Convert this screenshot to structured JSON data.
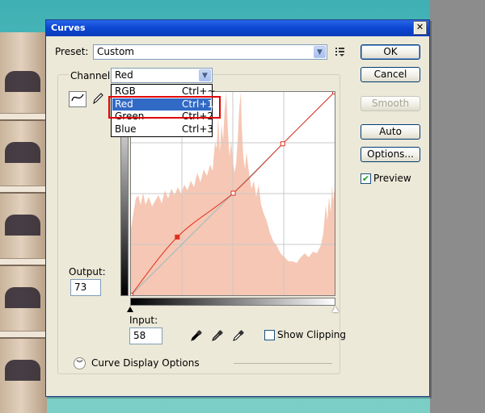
{
  "dialog": {
    "title": "Curves",
    "close_glyph": "✕"
  },
  "preset": {
    "label": "Preset:",
    "value": "Custom"
  },
  "channel": {
    "label": "Channel:",
    "value": "Red",
    "menu_items": [
      {
        "label": "RGB",
        "shortcut": "Ctrl+~",
        "selected": false
      },
      {
        "label": "Red",
        "shortcut": "Ctrl+1",
        "selected": true
      },
      {
        "label": "Green",
        "shortcut": "Ctrl+2",
        "selected": false
      },
      {
        "label": "Blue",
        "shortcut": "Ctrl+3",
        "selected": false
      }
    ]
  },
  "buttons": {
    "ok": "OK",
    "cancel": "Cancel",
    "smooth": "Smooth",
    "auto": "Auto",
    "options": "Options..."
  },
  "preview": {
    "label": "Preview",
    "checked": true
  },
  "output": {
    "label": "Output:",
    "value": "73"
  },
  "input": {
    "label": "Input:",
    "value": "58"
  },
  "show_clipping": {
    "label": "Show Clipping",
    "checked": false
  },
  "curve_display_options": {
    "label": "Curve Display Options"
  },
  "icons": {
    "preset_menu": "preset-options-icon",
    "curve_tool": "curve-tool-icon",
    "pencil_tool": "pencil-tool-icon",
    "black_eyedropper": "eyedropper-black-icon",
    "gray_eyedropper": "eyedropper-gray-icon",
    "white_eyedropper": "eyedropper-white-icon"
  },
  "colors": {
    "histogram": "#f6c7b4",
    "curve": "#e0301e",
    "highlight_box": "#e00000",
    "menu_selection": "#316ac5"
  },
  "curve_points": [
    [
      0,
      0
    ],
    [
      58,
      73
    ],
    [
      128,
      128
    ],
    [
      190,
      190
    ],
    [
      255,
      255
    ]
  ]
}
